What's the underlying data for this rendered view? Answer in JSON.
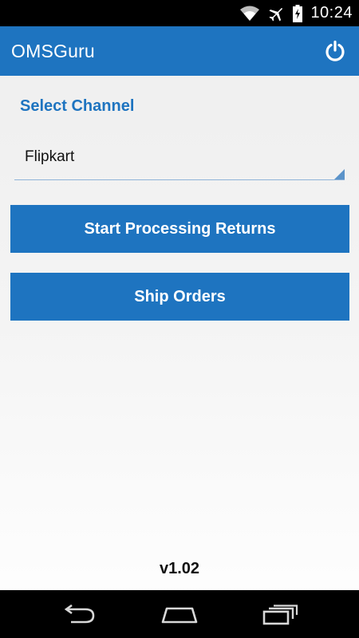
{
  "status_bar": {
    "clock": "10:24",
    "icons": [
      "wifi-icon",
      "airplane-icon",
      "battery-charging-icon"
    ]
  },
  "action_bar": {
    "title": "OMSGuru",
    "power_icon": "power-icon"
  },
  "channel": {
    "label": "Select Channel",
    "selected": "Flipkart"
  },
  "buttons": {
    "start_returns": "Start Processing Returns",
    "ship_orders": "Ship Orders"
  },
  "footer": {
    "version": "v1.02"
  },
  "nav_bar": {
    "icons": [
      "back-icon",
      "home-icon",
      "recents-icon"
    ]
  },
  "colors": {
    "accent": "#1e74c0",
    "status_bar_bg": "#000000",
    "nav_bar_bg": "#000000"
  }
}
